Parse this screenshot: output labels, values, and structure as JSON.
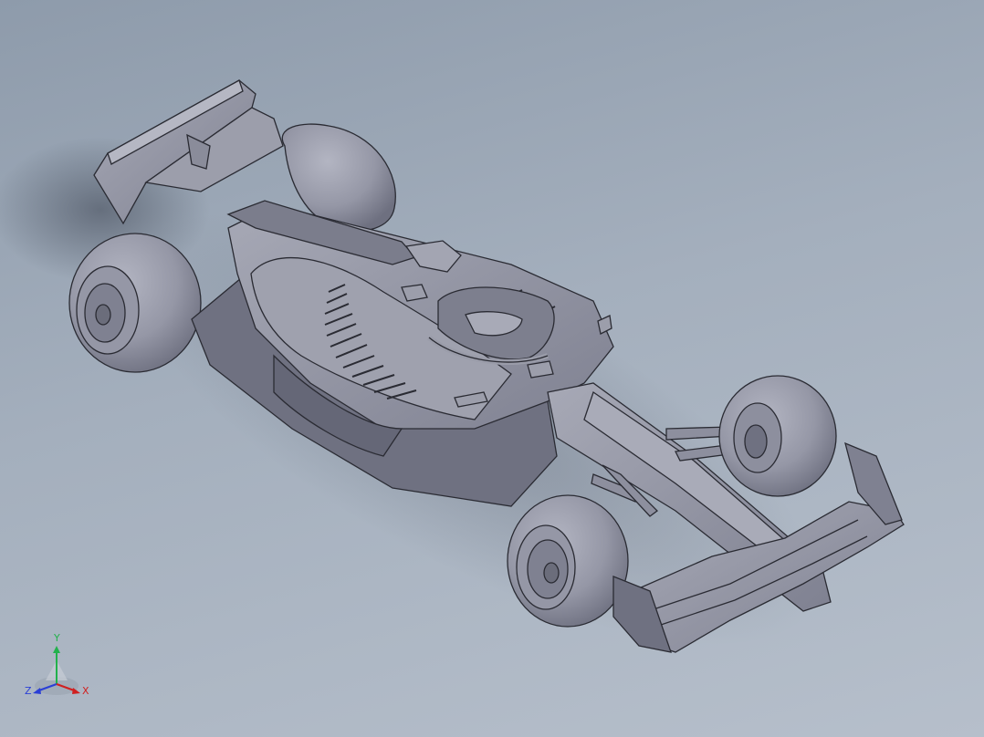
{
  "viewport": {
    "background_top": "#8e9bab",
    "background_bottom": "#b6bfcb"
  },
  "model": {
    "icon": "formula-1-car-model",
    "body_color": "#8d8f9e",
    "highlight_color": "#aeb0bd",
    "shadow_color": "#5c5e6c",
    "edge_color": "#2a2b33"
  },
  "triad": {
    "icon": "coordinate-triad-icon",
    "y_label": "Y",
    "z_label": "Z",
    "x_label": "X",
    "y_color": "#22b14c",
    "z_color": "#2a3fd6",
    "x_color": "#d02020"
  }
}
